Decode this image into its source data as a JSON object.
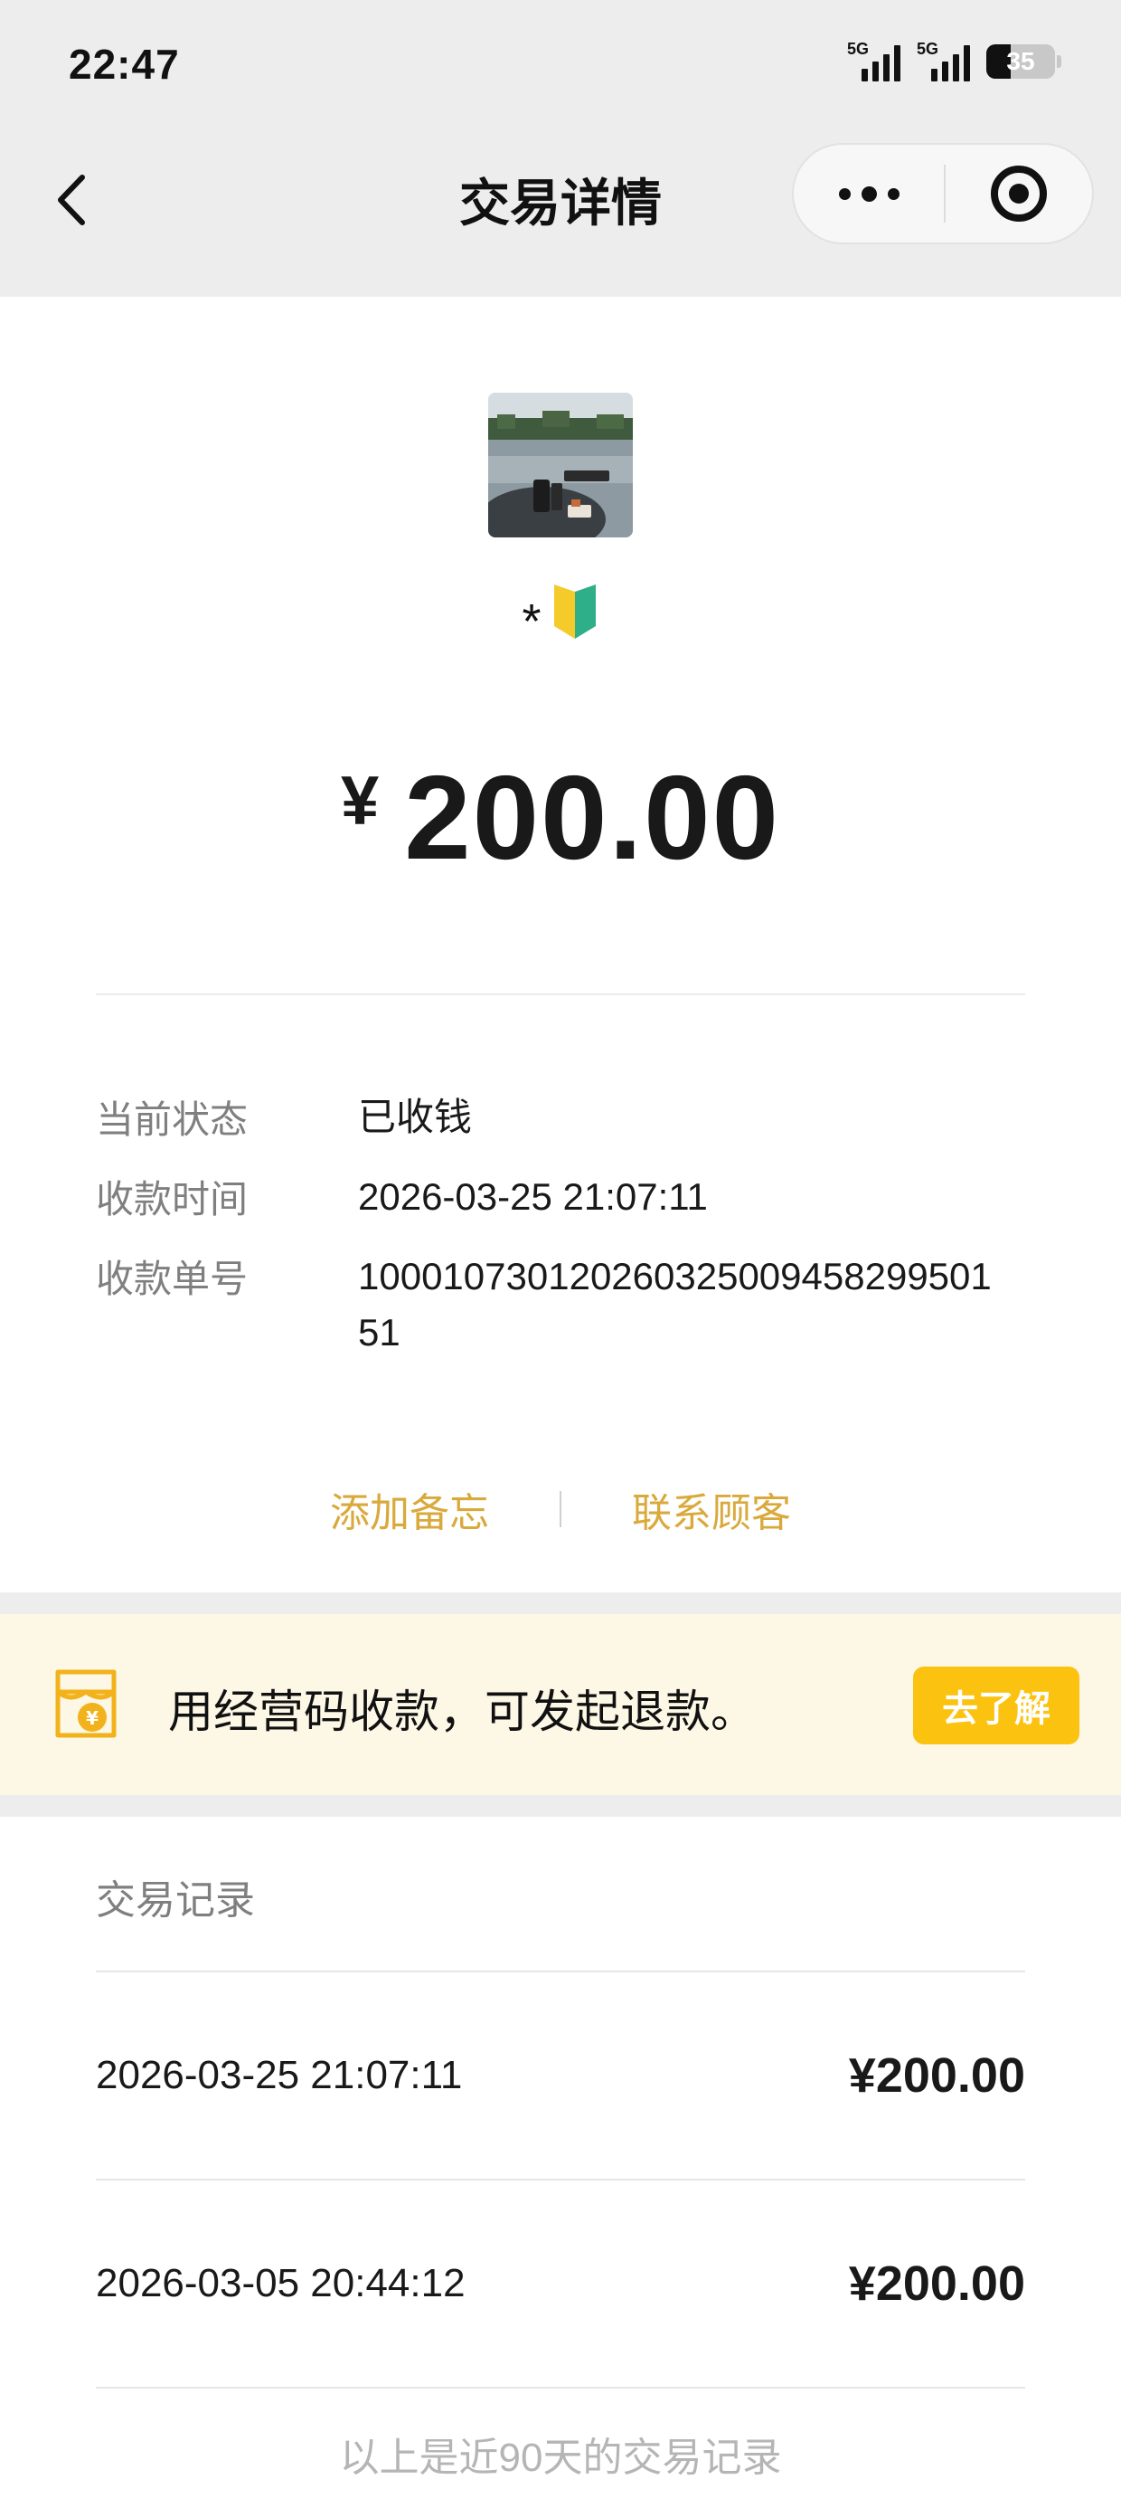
{
  "status_bar": {
    "time": "22:47",
    "signal_1_label": "5G",
    "signal_2_label": "5G",
    "battery_percent": "35"
  },
  "nav": {
    "title": "交易详情",
    "back_icon": "chevron-left-icon",
    "more_icon": "more-dots-icon",
    "close_icon": "mini-program-close-icon"
  },
  "payer": {
    "nickname_prefix": "*",
    "nickname_icon": "beginner-badge-icon"
  },
  "payment": {
    "currency_symbol": "¥",
    "amount": "200.00"
  },
  "details": [
    {
      "label": "当前状态",
      "value": "已收钱"
    },
    {
      "label": "收款时间",
      "value": "2026-03-25 21:07:11"
    },
    {
      "label": "收款单号",
      "value": "10001073012026032500945829950151"
    }
  ],
  "actions": {
    "add_note": "添加备忘",
    "contact_customer": "联系顾客"
  },
  "promo": {
    "icon": "shop-yen-icon",
    "text": "用经营码收款，可发起退款。",
    "button": "去了解"
  },
  "records": {
    "title": "交易记录",
    "items": [
      {
        "time": "2026-03-25 21:07:11",
        "amount": "¥200.00"
      },
      {
        "time": "2026-03-05 20:44:12",
        "amount": "¥200.00"
      }
    ],
    "footer": "以上是近90天的交易记录"
  },
  "colors": {
    "accent_link": "#d9a93b",
    "promo_button": "#fbc210",
    "promo_background": "#fdf7e6",
    "page_background": "#ededed"
  }
}
